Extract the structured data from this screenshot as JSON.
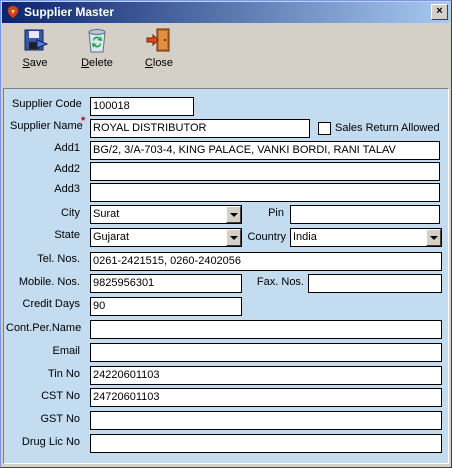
{
  "window": {
    "title": "Supplier Master",
    "close_glyph": "×"
  },
  "toolbar": {
    "save": {
      "label": "Save",
      "icon": "save-disk-icon"
    },
    "delete": {
      "label": "Delete",
      "icon": "recycle-bin-icon"
    },
    "close": {
      "label": "Close",
      "icon": "exit-door-icon"
    }
  },
  "form": {
    "supplier_code": {
      "label": "Supplier Code",
      "value": "100018"
    },
    "supplier_name": {
      "label": "Supplier Name",
      "required_mark": "*",
      "value": "ROYAL DISTRIBUTOR"
    },
    "sales_return": {
      "label": "Sales Return Allowed",
      "checked": false
    },
    "add1": {
      "label": "Add1",
      "value": "BG/2, 3/A-703-4, KING PALACE, VANKI BORDI, RANI TALAV"
    },
    "add2": {
      "label": "Add2",
      "value": ""
    },
    "add3": {
      "label": "Add3",
      "value": ""
    },
    "city": {
      "label": "City",
      "value": "Surat"
    },
    "pin": {
      "label": "Pin",
      "value": ""
    },
    "state": {
      "label": "State",
      "value": "Gujarat"
    },
    "country": {
      "label": "Country",
      "value": "India"
    },
    "tel": {
      "label": "Tel. Nos.",
      "value": "0261-2421515, 0260-2402056"
    },
    "mobile": {
      "label": "Mobile. Nos.",
      "value": "9825956301"
    },
    "fax": {
      "label": "Fax. Nos.",
      "value": ""
    },
    "credit_days": {
      "label": "Credit Days",
      "value": "90"
    },
    "contact": {
      "label": "Cont.Per.Name",
      "value": ""
    },
    "email": {
      "label": "Email",
      "value": ""
    },
    "tin": {
      "label": "Tin No",
      "value": "24220601103"
    },
    "cst": {
      "label": "CST No",
      "value": "24720601103"
    },
    "gst": {
      "label": "GST No",
      "value": ""
    },
    "drug_lic": {
      "label": "Drug Lic No",
      "value": ""
    }
  },
  "colors": {
    "titlebar_start": "#0a246a",
    "titlebar_end": "#a6caf0",
    "panel_bg": "#c4dcf0",
    "window_bg": "#d4d0c8"
  }
}
